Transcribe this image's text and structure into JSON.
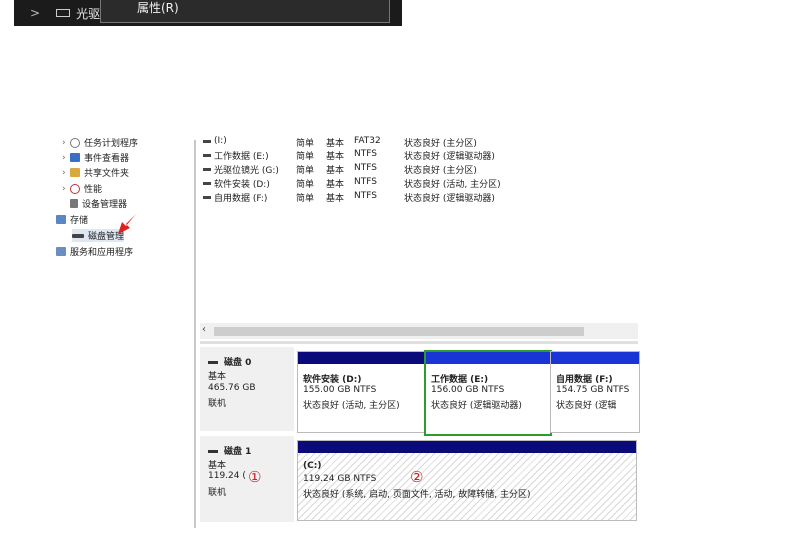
{
  "explorer": {
    "drive_label": "光驱"
  },
  "context_menu": {
    "item": "属性(R)"
  },
  "tree": [
    {
      "label": "任务计划程序"
    },
    {
      "label": "事件查看器"
    },
    {
      "label": "共享文件夹"
    },
    {
      "label": "性能"
    },
    {
      "label": "设备管理器"
    },
    {
      "label": "存储"
    },
    {
      "label": "磁盘管理"
    },
    {
      "label": "服务和应用程序"
    }
  ],
  "volumes": [
    {
      "name": "(I:)",
      "layout": "简单",
      "type": "基本",
      "fs": "FAT32",
      "status": "状态良好 (主分区)"
    },
    {
      "name": "工作数据 (E:)",
      "layout": "简单",
      "type": "基本",
      "fs": "NTFS",
      "status": "状态良好 (逻辑驱动器)"
    },
    {
      "name": "光驱位镜光 (G:)",
      "layout": "简单",
      "type": "基本",
      "fs": "NTFS",
      "status": "状态良好 (主分区)"
    },
    {
      "name": "软件安装 (D:)",
      "layout": "简单",
      "type": "基本",
      "fs": "NTFS",
      "status": "状态良好 (活动, 主分区)"
    },
    {
      "name": "自用数据 (F:)",
      "layout": "简单",
      "type": "基本",
      "fs": "NTFS",
      "status": "状态良好 (逻辑驱动器)"
    }
  ],
  "disk0": {
    "name": "磁盘 0",
    "type": "基本",
    "size": "465.76 GB",
    "state": "联机",
    "partitions": [
      {
        "name": "软件安装 (D:)",
        "size": "155.00 GB NTFS",
        "status": "状态良好 (活动, 主分区)"
      },
      {
        "name": "工作数据 (E:)",
        "size": "156.00 GB NTFS",
        "status": "状态良好 (逻辑驱动器)"
      },
      {
        "name": "自用数据 (F:)",
        "size": "154.75 GB NTFS",
        "status": "状态良好 (逻辑"
      }
    ]
  },
  "disk1": {
    "name": "磁盘 1",
    "type": "基本",
    "size": "119.24 (",
    "state": "联机",
    "partition": {
      "name": "(C:)",
      "size": "119.24 GB NTFS",
      "status": "状态良好 (系统, 启动, 页面文件, 活动, 故障转储, 主分区)"
    }
  },
  "markers": [
    "①",
    "②"
  ],
  "colors": {
    "primary_bar": "#0a0a7a",
    "logical_bar": "#1a35d6",
    "selected_border": "#2e9b2e",
    "arrow": "#e02020"
  }
}
